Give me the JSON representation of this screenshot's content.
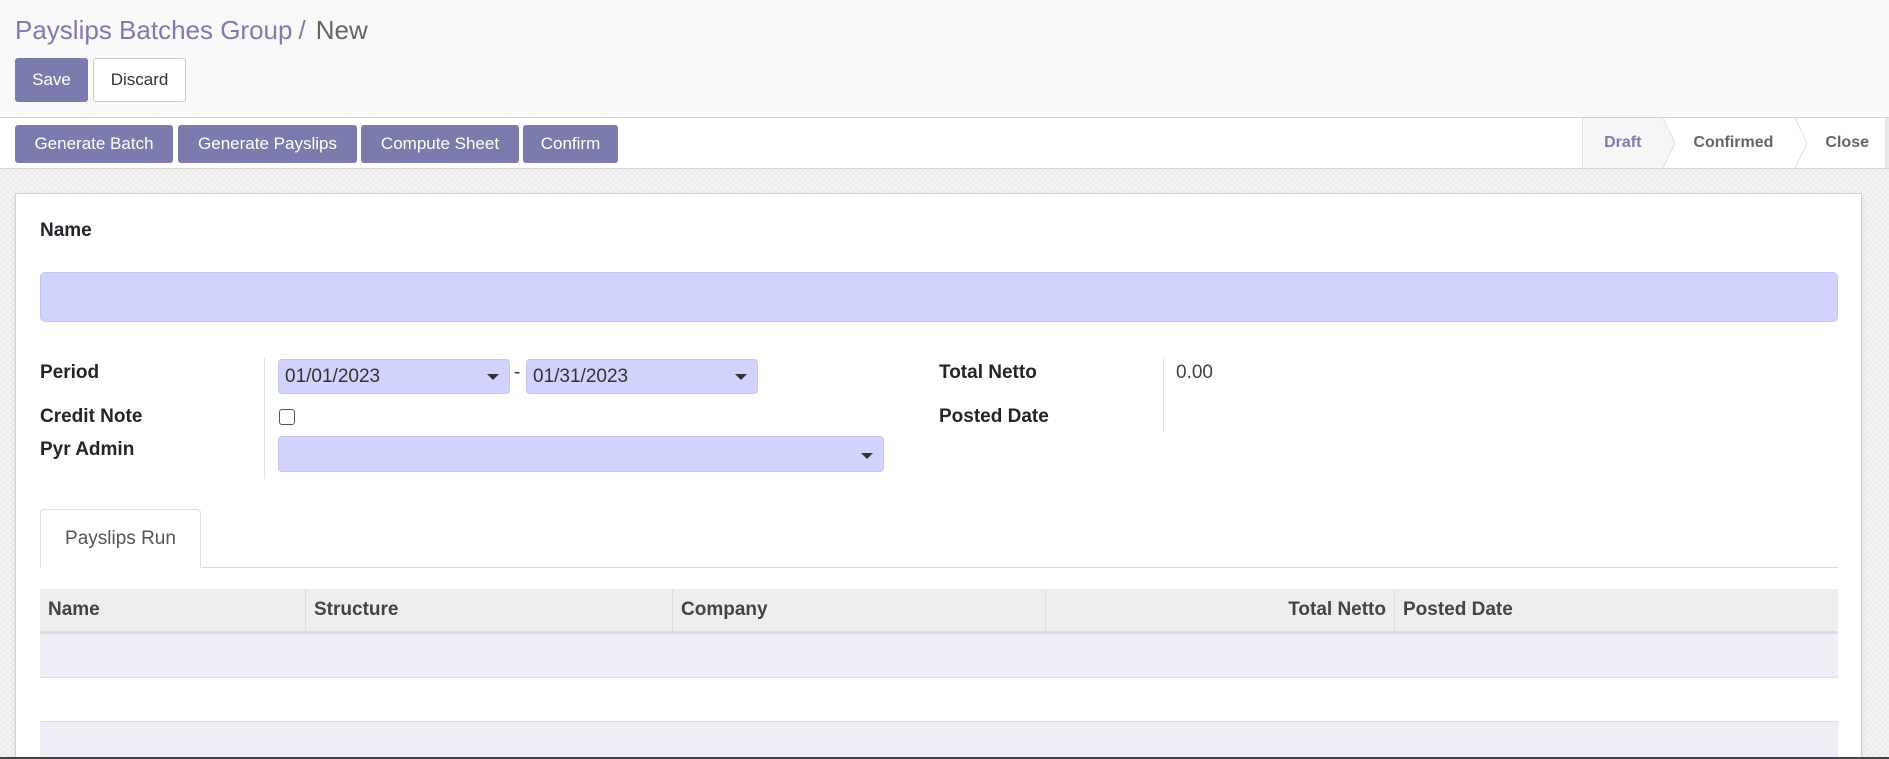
{
  "breadcrumb": {
    "parent": "Payslips Batches Group",
    "separator": "/",
    "current": "New"
  },
  "toolbar": {
    "save_label": "Save",
    "discard_label": "Discard"
  },
  "actions": [
    {
      "label": "Generate Batch"
    },
    {
      "label": "Generate Payslips"
    },
    {
      "label": "Compute Sheet"
    },
    {
      "label": "Confirm"
    }
  ],
  "statusbar": {
    "steps": [
      {
        "label": "Draft",
        "active": true
      },
      {
        "label": "Confirmed",
        "active": false
      },
      {
        "label": "Close",
        "active": false
      }
    ]
  },
  "form": {
    "name": {
      "label": "Name",
      "value": ""
    },
    "period": {
      "label": "Period",
      "date_from": "01/01/2023",
      "separator": "-",
      "date_to": "01/31/2023"
    },
    "credit_note": {
      "label": "Credit Note",
      "checked": false
    },
    "pyr_admin": {
      "label": "Pyr Admin",
      "value": ""
    },
    "total_netto": {
      "label": "Total Netto",
      "value": "0.00"
    },
    "posted_date": {
      "label": "Posted Date",
      "value": ""
    }
  },
  "notebook": {
    "tabs": [
      {
        "label": "Payslips Run",
        "active": true
      }
    ]
  },
  "table": {
    "columns": [
      {
        "label": "Name"
      },
      {
        "label": "Structure"
      },
      {
        "label": "Company"
      },
      {
        "label": "Total Netto"
      },
      {
        "label": "Posted Date"
      }
    ],
    "rows": []
  },
  "colors": {
    "primary": "#7c7bad",
    "required_field": "#d2d2ff",
    "row_stripe": "#eeeef7"
  }
}
